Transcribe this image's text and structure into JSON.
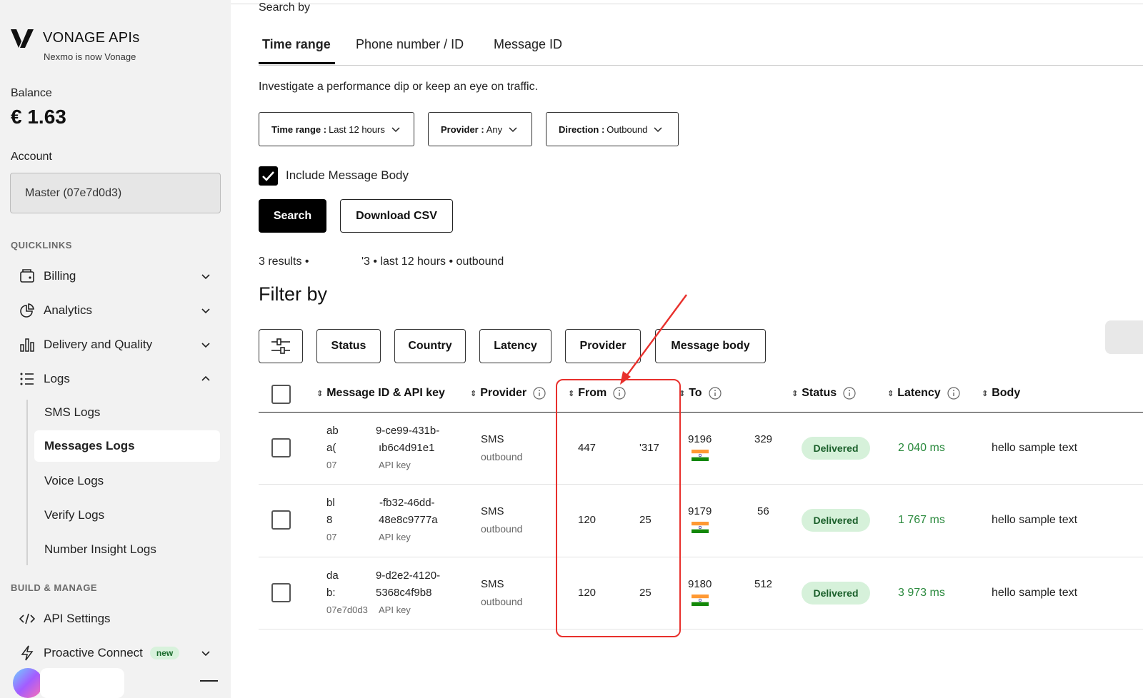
{
  "sidebar": {
    "brand_title": "VONAGE APIs",
    "brand_subtitle": "Nexmo is now Vonage",
    "balance_label": "Balance",
    "balance_value": "€ 1.63",
    "account_label": "Account",
    "account_value": "Master (07e7d0d3)",
    "quicklinks_heading": "QUICKLINKS",
    "quicklinks": [
      {
        "label": "Billing",
        "icon": "wallet-icon"
      },
      {
        "label": "Analytics",
        "icon": "pie-chart-icon"
      },
      {
        "label": "Delivery and Quality",
        "icon": "bar-chart-icon"
      },
      {
        "label": "Logs",
        "icon": "list-icon"
      }
    ],
    "logs_sub": [
      "SMS Logs",
      "Messages Logs",
      "Voice Logs",
      "Verify Logs",
      "Number Insight Logs"
    ],
    "build_heading": "BUILD & MANAGE",
    "build_items": [
      {
        "label": "API Settings",
        "icon": "code-icon"
      },
      {
        "label": "Proactive Connect",
        "icon": "lightning-icon",
        "badge": "new"
      }
    ]
  },
  "main": {
    "search_by": "Search by",
    "tabs": [
      "Time range",
      "Phone number / ID",
      "Message ID"
    ],
    "intro": "Investigate a performance dip or keep an eye on traffic.",
    "dropdowns": [
      {
        "key": "Time range :",
        "value": "Last 12 hours"
      },
      {
        "key": "Provider :",
        "value": "Any"
      },
      {
        "key": "Direction :",
        "value": "Outbound"
      }
    ],
    "include_body_label": "Include Message Body",
    "search_button": "Search",
    "download_button": "Download CSV",
    "results_a": "3 results •",
    "results_b": "'3 • last 12 hours • outbound",
    "filter_title": "Filter by",
    "filters": [
      "Status",
      "Country",
      "Latency",
      "Provider",
      "Message body"
    ]
  },
  "table": {
    "headers": [
      "Message ID & API key",
      "Provider",
      "From",
      "To",
      "Status",
      "Latency",
      "Body"
    ],
    "rows": [
      {
        "id_a": "ab",
        "id_b": "9-ce99-431b-",
        "id_c": "a(",
        "id_d": "ıb6c4d91e1",
        "key_a": "07",
        "key_b": "API key",
        "provider": "SMS",
        "direction": "outbound",
        "from_a": "447",
        "from_b": "'317",
        "to_a": "9196",
        "to_b": "329",
        "status": "Delivered",
        "latency": "2 040 ms",
        "body": "hello sample text"
      },
      {
        "id_a": "bl",
        "id_b": "-fb32-46dd-",
        "id_c": "8",
        "id_d": "48e8c9777a",
        "key_a": "07",
        "key_b": "API key",
        "provider": "SMS",
        "direction": "outbound",
        "from_a": "120",
        "from_b": "25",
        "to_a": "9179",
        "to_b": "56",
        "status": "Delivered",
        "latency": "1 767 ms",
        "body": "hello sample text"
      },
      {
        "id_a": "da",
        "id_b": "9-d2e2-4120-",
        "id_c": "b:",
        "id_d": "5368c4f9b8",
        "key_a": "07e7d0d3",
        "key_b": "API key",
        "provider": "SMS",
        "direction": "outbound",
        "from_a": "120",
        "from_b": "25",
        "to_a": "9180",
        "to_b": "512",
        "status": "Delivered",
        "latency": "3 973 ms",
        "body": "hello sample text"
      }
    ]
  },
  "colors": {
    "accent": "#000000",
    "status_bg": "#d6f1da",
    "latency_green": "#2b8a3e",
    "annotation_red": "#e8302c"
  }
}
